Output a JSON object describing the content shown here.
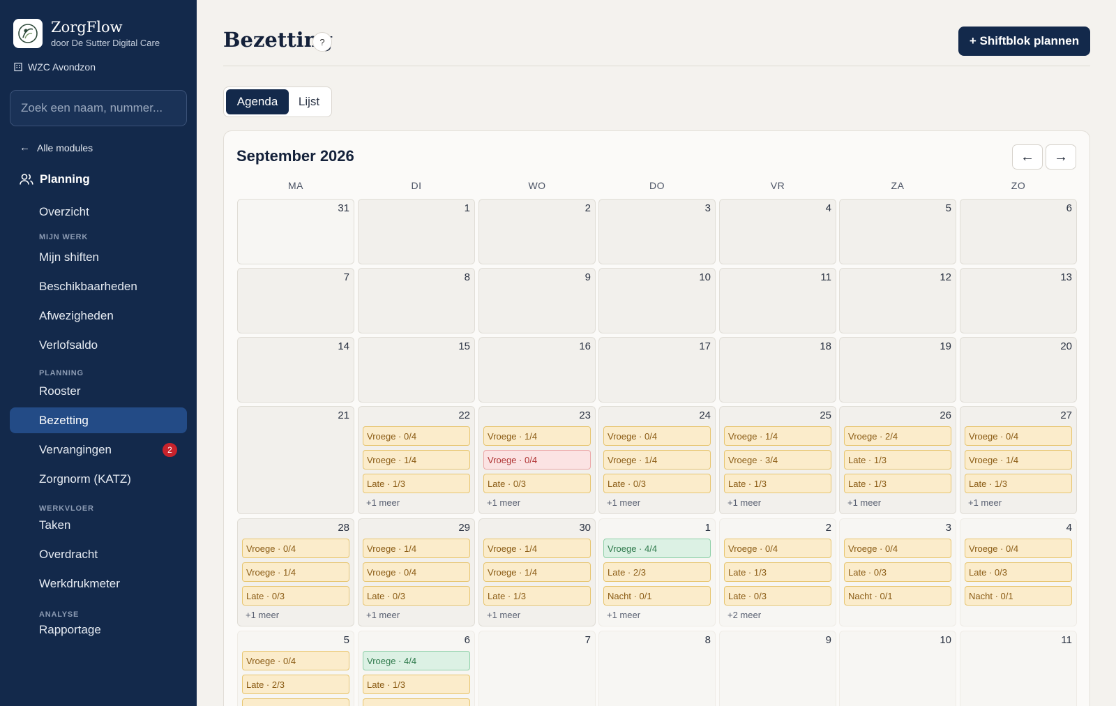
{
  "app": {
    "name": "ZorgFlow",
    "subtitle": "door De Sutter Digital Care",
    "org": "WZC Avondzon"
  },
  "search": {
    "placeholder": "Zoek een naam, nummer..."
  },
  "sidebar": {
    "back_label": "Alle modules",
    "module": "Planning",
    "items": [
      {
        "label": "Overzicht"
      },
      {
        "section": "MIJN WERK"
      },
      {
        "label": "Mijn shiften"
      },
      {
        "label": "Beschikbaarheden"
      },
      {
        "label": "Afwezigheden"
      },
      {
        "label": "Verlofsaldo"
      },
      {
        "section": "PLANNING"
      },
      {
        "label": "Rooster"
      },
      {
        "label": "Bezetting",
        "active": true
      },
      {
        "label": "Vervangingen",
        "badge": "2"
      },
      {
        "label": "Zorgnorm (KATZ)"
      },
      {
        "section": "WERKVLOER"
      },
      {
        "label": "Taken"
      },
      {
        "label": "Overdracht"
      },
      {
        "label": "Werkdrukmeter"
      },
      {
        "section": "ANALYSE"
      },
      {
        "label": "Rapportage"
      }
    ]
  },
  "header": {
    "title": "Bezetting",
    "help": "?",
    "primary_button": "+ Shiftblok plannen"
  },
  "tabs": [
    {
      "label": "Agenda",
      "active": true
    },
    {
      "label": "Lijst"
    }
  ],
  "calendar": {
    "month_label": "September 2026",
    "prev": "←",
    "next": "→",
    "weekdays": [
      "MA",
      "DI",
      "WO",
      "DO",
      "VR",
      "ZA",
      "ZO"
    ],
    "weeks": [
      [
        {
          "day": "31",
          "prev": true
        },
        {
          "day": "1"
        },
        {
          "day": "2"
        },
        {
          "day": "3"
        },
        {
          "day": "4"
        },
        {
          "day": "5"
        },
        {
          "day": "6"
        }
      ],
      [
        {
          "day": "7"
        },
        {
          "day": "8"
        },
        {
          "day": "9"
        },
        {
          "day": "10"
        },
        {
          "day": "11"
        },
        {
          "day": "12"
        },
        {
          "day": "13"
        }
      ],
      [
        {
          "day": "14"
        },
        {
          "day": "15"
        },
        {
          "day": "16"
        },
        {
          "day": "17"
        },
        {
          "day": "18"
        },
        {
          "day": "19"
        },
        {
          "day": "20"
        }
      ],
      [
        {
          "day": "21"
        },
        {
          "day": "22",
          "shifts": [
            {
              "label": "Vroege · 0/4",
              "status": "warn"
            },
            {
              "label": "Vroege · 1/4",
              "status": "warn"
            },
            {
              "label": "Late · 1/3",
              "status": "warn"
            }
          ],
          "more": "+1 meer"
        },
        {
          "day": "23",
          "shifts": [
            {
              "label": "Vroege · 1/4",
              "status": "warn"
            },
            {
              "label": "Vroege · 0/4",
              "status": "danger"
            },
            {
              "label": "Late · 0/3",
              "status": "warn"
            }
          ],
          "more": "+1 meer"
        },
        {
          "day": "24",
          "shifts": [
            {
              "label": "Vroege · 0/4",
              "status": "warn"
            },
            {
              "label": "Vroege · 1/4",
              "status": "warn"
            },
            {
              "label": "Late · 0/3",
              "status": "warn"
            }
          ],
          "more": "+1 meer"
        },
        {
          "day": "25",
          "shifts": [
            {
              "label": "Vroege · 1/4",
              "status": "warn"
            },
            {
              "label": "Vroege · 3/4",
              "status": "warn"
            },
            {
              "label": "Late · 1/3",
              "status": "warn"
            }
          ],
          "more": "+1 meer"
        },
        {
          "day": "26",
          "shifts": [
            {
              "label": "Vroege · 2/4",
              "status": "warn"
            },
            {
              "label": "Late · 1/3",
              "status": "warn"
            },
            {
              "label": "Late · 1/3",
              "status": "warn"
            }
          ],
          "more": "+1 meer"
        },
        {
          "day": "27",
          "shifts": [
            {
              "label": "Vroege · 0/4",
              "status": "warn"
            },
            {
              "label": "Vroege · 1/4",
              "status": "warn"
            },
            {
              "label": "Late · 1/3",
              "status": "warn"
            }
          ],
          "more": "+1 meer"
        }
      ],
      [
        {
          "day": "28",
          "shifts": [
            {
              "label": "Vroege · 0/4",
              "status": "warn"
            },
            {
              "label": "Vroege · 1/4",
              "status": "warn"
            },
            {
              "label": "Late · 0/3",
              "status": "warn"
            }
          ],
          "more": "+1 meer"
        },
        {
          "day": "29",
          "shifts": [
            {
              "label": "Vroege · 1/4",
              "status": "warn"
            },
            {
              "label": "Vroege · 0/4",
              "status": "warn"
            },
            {
              "label": "Late · 0/3",
              "status": "warn"
            }
          ],
          "more": "+1 meer"
        },
        {
          "day": "30",
          "shifts": [
            {
              "label": "Vroege · 1/4",
              "status": "warn"
            },
            {
              "label": "Vroege · 1/4",
              "status": "warn"
            },
            {
              "label": "Late · 1/3",
              "status": "warn"
            }
          ],
          "more": "+1 meer"
        },
        {
          "day": "1",
          "other": true,
          "shifts": [
            {
              "label": "Vroege · 4/4",
              "status": "ok"
            },
            {
              "label": "Late · 2/3",
              "status": "warn"
            },
            {
              "label": "Nacht · 0/1",
              "status": "warn"
            }
          ],
          "more": "+1 meer"
        },
        {
          "day": "2",
          "other": true,
          "shifts": [
            {
              "label": "Vroege · 0/4",
              "status": "warn"
            },
            {
              "label": "Late · 1/3",
              "status": "warn"
            },
            {
              "label": "Late · 0/3",
              "status": "warn"
            }
          ],
          "more": "+2 meer"
        },
        {
          "day": "3",
          "other": true,
          "shifts": [
            {
              "label": "Vroege · 0/4",
              "status": "warn"
            },
            {
              "label": "Late · 0/3",
              "status": "warn"
            },
            {
              "label": "Nacht · 0/1",
              "status": "warn"
            }
          ]
        },
        {
          "day": "4",
          "other": true,
          "shifts": [
            {
              "label": "Vroege · 0/4",
              "status": "warn"
            },
            {
              "label": "Late · 0/3",
              "status": "warn"
            },
            {
              "label": "Nacht · 0/1",
              "status": "warn"
            }
          ]
        }
      ],
      [
        {
          "day": "5",
          "other": true,
          "shifts": [
            {
              "label": "Vroege · 0/4",
              "status": "warn"
            },
            {
              "label": "Late · 2/3",
              "status": "warn"
            },
            {
              "label": "",
              "status": "warn"
            }
          ]
        },
        {
          "day": "6",
          "other": true,
          "shifts": [
            {
              "label": "Vroege · 4/4",
              "status": "ok"
            },
            {
              "label": "Late · 1/3",
              "status": "warn"
            },
            {
              "label": "",
              "status": "warn"
            }
          ]
        },
        {
          "day": "7",
          "other": true
        },
        {
          "day": "8",
          "other": true
        },
        {
          "day": "9",
          "other": true
        },
        {
          "day": "10",
          "other": true
        },
        {
          "day": "11",
          "other": true
        }
      ]
    ]
  }
}
